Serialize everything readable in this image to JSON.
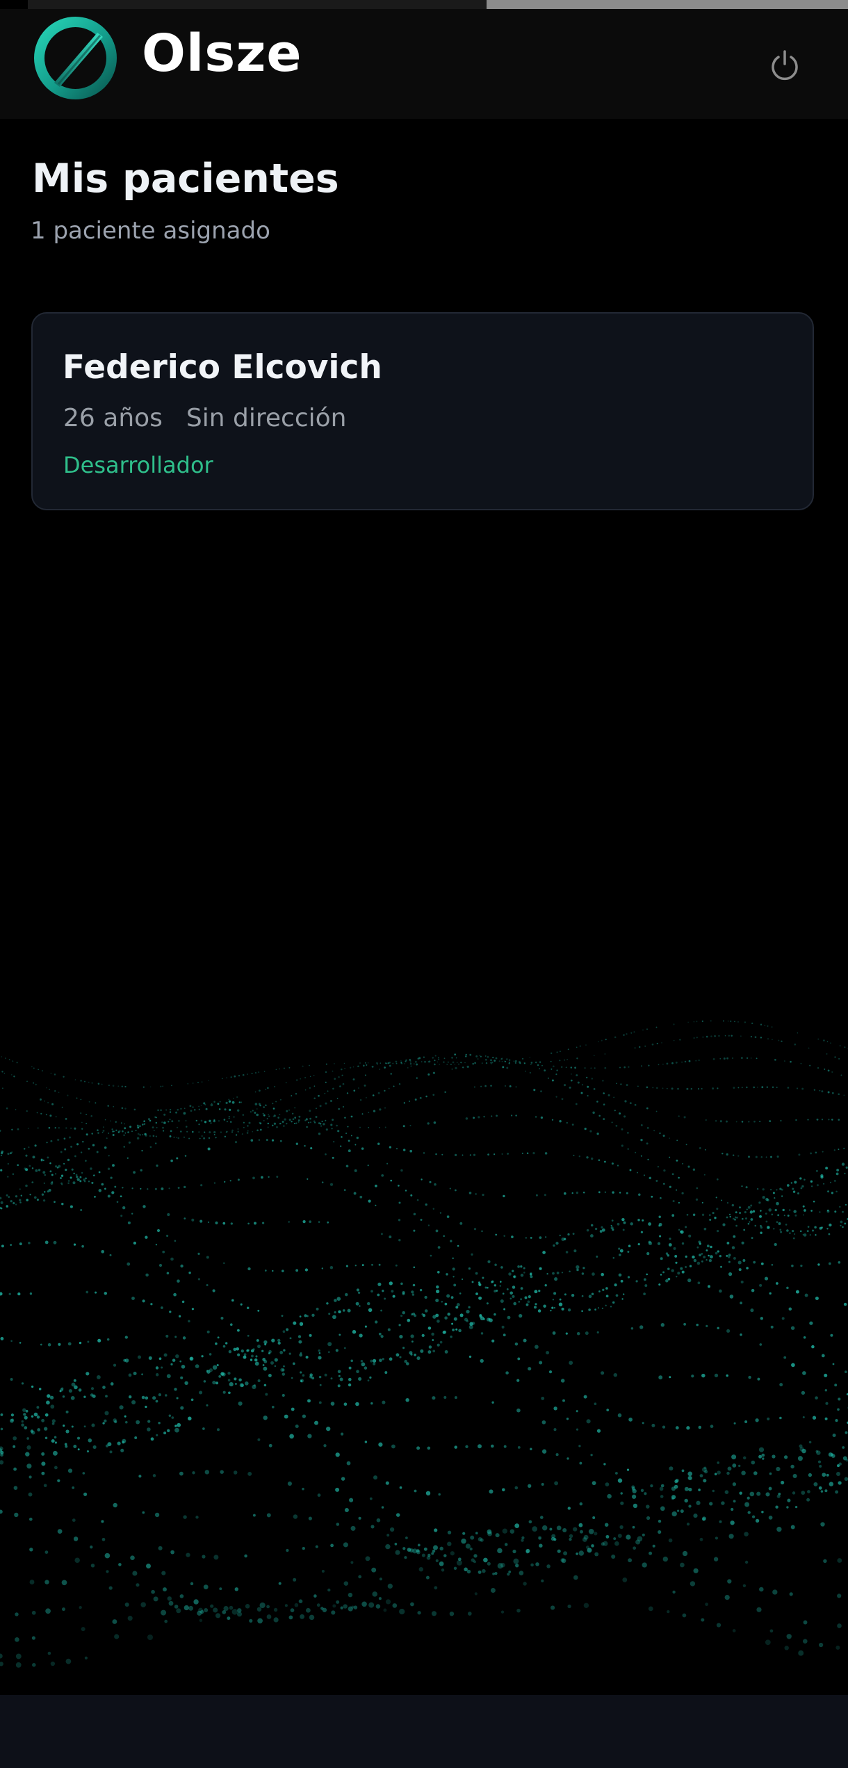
{
  "header": {
    "brand": "Olsze",
    "logo_icon": "olsze-logo-icon",
    "power_icon": "power-icon"
  },
  "main": {
    "title": "Mis pacientes",
    "subtitle": "1 paciente asignado",
    "patients": [
      {
        "name": "Federico Elcovich",
        "age": "26 años",
        "address": "Sin dirección",
        "role": "Desarrollador"
      }
    ]
  },
  "colors": {
    "accent": "#2fbf8b",
    "teal": "#1fb5a4",
    "background": "#000000",
    "card": "#0e121a"
  }
}
